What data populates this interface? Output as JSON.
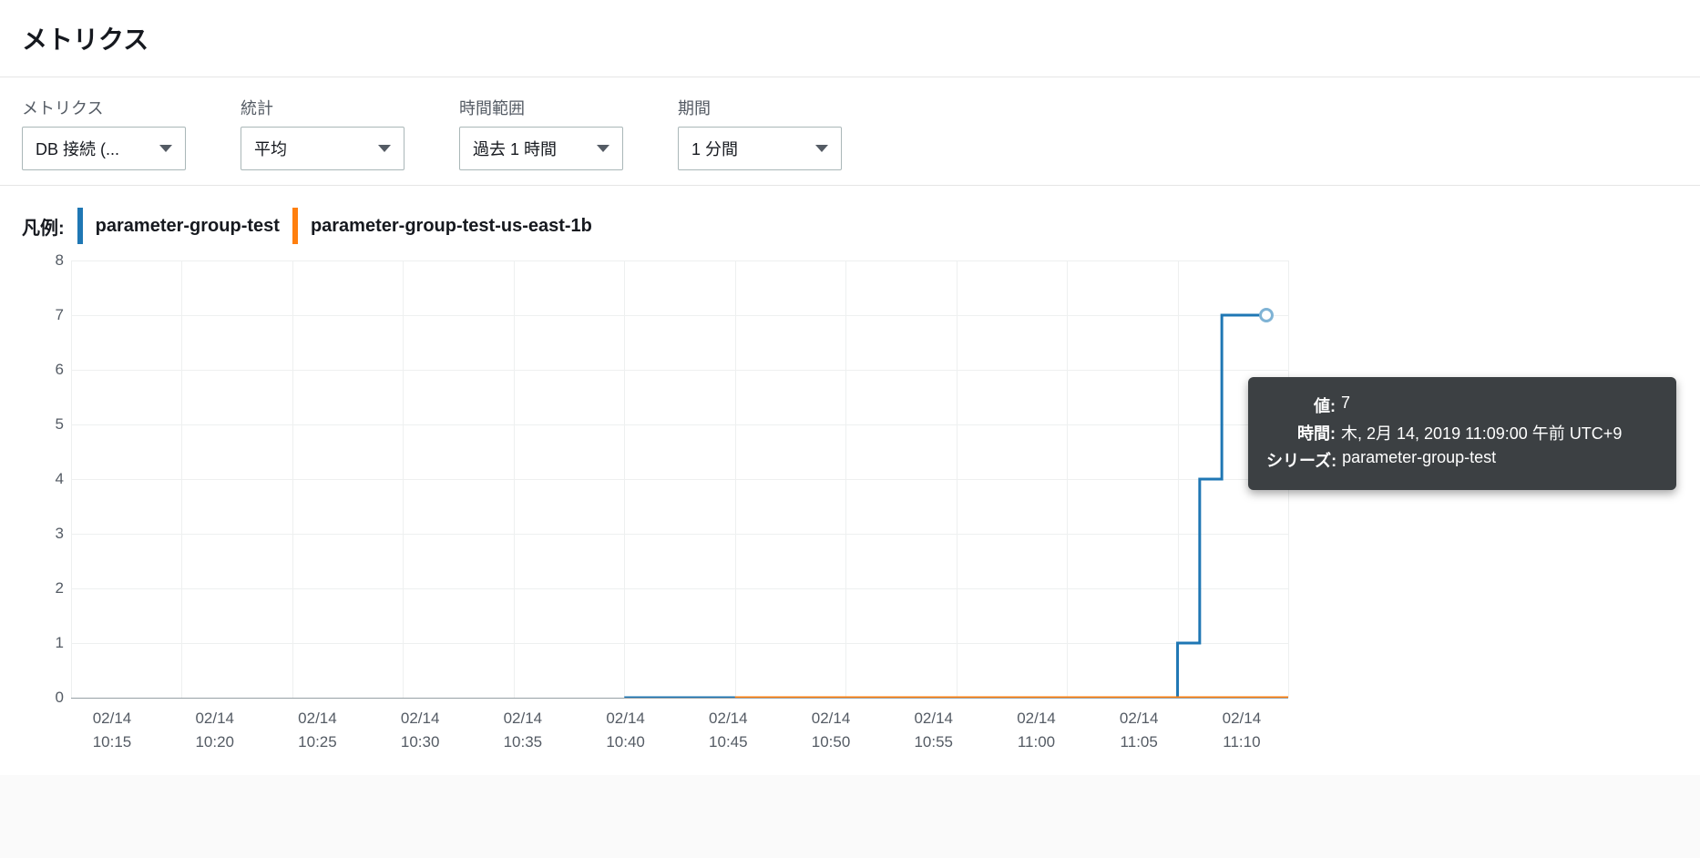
{
  "header": {
    "title": "メトリクス"
  },
  "controls": {
    "metric": {
      "label": "メトリクス",
      "value": "DB 接続 (..."
    },
    "stat": {
      "label": "統計",
      "value": "平均"
    },
    "range": {
      "label": "時間範囲",
      "value": "過去 1 時間"
    },
    "period": {
      "label": "期間",
      "value": "1 分間"
    }
  },
  "legend": {
    "label": "凡例:",
    "items": [
      {
        "name": "parameter-group-test",
        "color": "#1f77b4"
      },
      {
        "name": "parameter-group-test-us-east-1b",
        "color": "#ff7f0e"
      }
    ]
  },
  "chart_data": {
    "type": "line",
    "ylim": [
      0,
      8
    ],
    "yticks": [
      0,
      1,
      2,
      3,
      4,
      5,
      6,
      7,
      8
    ],
    "xticks": [
      {
        "date": "02/14",
        "time": "10:15"
      },
      {
        "date": "02/14",
        "time": "10:20"
      },
      {
        "date": "02/14",
        "time": "10:25"
      },
      {
        "date": "02/14",
        "time": "10:30"
      },
      {
        "date": "02/14",
        "time": "10:35"
      },
      {
        "date": "02/14",
        "time": "10:40"
      },
      {
        "date": "02/14",
        "time": "10:45"
      },
      {
        "date": "02/14",
        "time": "10:50"
      },
      {
        "date": "02/14",
        "time": "10:55"
      },
      {
        "date": "02/14",
        "time": "11:00"
      },
      {
        "date": "02/14",
        "time": "11:05"
      },
      {
        "date": "02/14",
        "time": "11:10"
      }
    ],
    "series": [
      {
        "name": "parameter-group-test",
        "color": "#1f77b4",
        "x_start_index": 5,
        "values": [
          0,
          0,
          0,
          0,
          0,
          0,
          0,
          0,
          0,
          0,
          0,
          0,
          0,
          0,
          0,
          0,
          0,
          0,
          0,
          0,
          0,
          0,
          0,
          0,
          0,
          1,
          4,
          7,
          7,
          7
        ]
      },
      {
        "name": "parameter-group-test-us-east-1b",
        "color": "#ff7f0e",
        "x_start_index": 6,
        "values": [
          0,
          0,
          0,
          0,
          0,
          0,
          0,
          0,
          0,
          0,
          0,
          0,
          0,
          0,
          0,
          0,
          0,
          0,
          0,
          0,
          0,
          0,
          0,
          0,
          0,
          0
        ]
      }
    ]
  },
  "tooltip": {
    "rows": [
      {
        "key": "値:",
        "val": "7"
      },
      {
        "key": "時間:",
        "val": "木, 2月 14, 2019 11:09:00 午前 UTC+9"
      },
      {
        "key": "シリーズ:",
        "val": "parameter-group-test"
      }
    ]
  },
  "hover_point": {
    "tick_pos": 10.8,
    "y": 7
  }
}
